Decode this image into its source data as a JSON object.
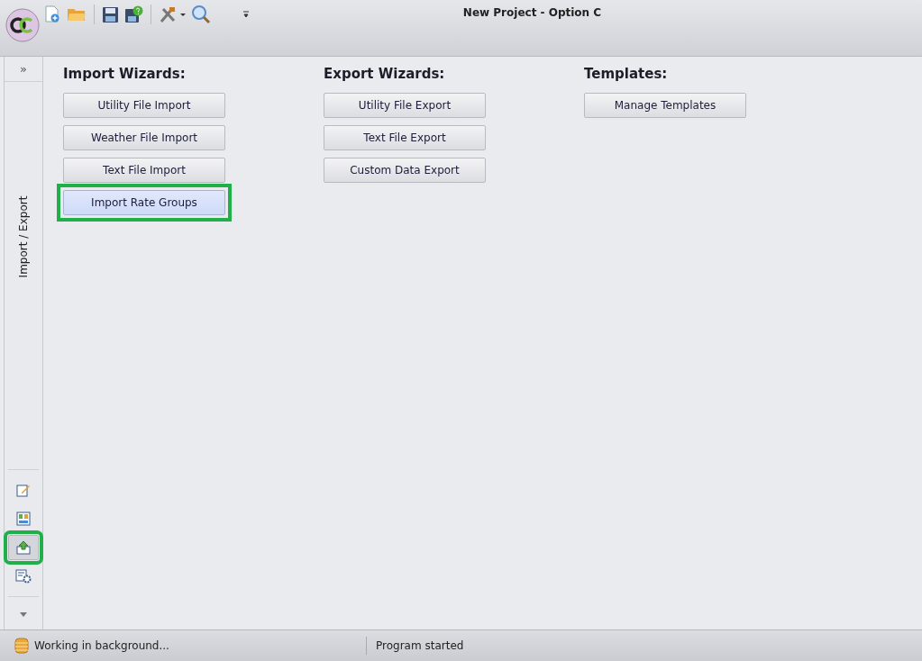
{
  "window": {
    "title": "New Project - Option C"
  },
  "sidebar": {
    "expand": "»",
    "panel_title": "Import / Export",
    "nav_items": [
      {
        "kind": "edit",
        "selected": false,
        "highlighted": false
      },
      {
        "kind": "layout",
        "selected": false,
        "highlighted": false
      },
      {
        "kind": "export",
        "selected": true,
        "highlighted": true
      },
      {
        "kind": "settings",
        "selected": false,
        "highlighted": false
      }
    ]
  },
  "sections": [
    {
      "title": "Import Wizards:",
      "buttons": [
        {
          "label": "Utility File Import",
          "hovered": false,
          "highlighted": false
        },
        {
          "label": "Weather File Import",
          "hovered": false,
          "highlighted": false
        },
        {
          "label": "Text File Import",
          "hovered": false,
          "highlighted": false
        },
        {
          "label": "Import Rate Groups",
          "hovered": true,
          "highlighted": true
        }
      ]
    },
    {
      "title": "Export Wizards:",
      "buttons": [
        {
          "label": "Utility File Export",
          "hovered": false,
          "highlighted": false
        },
        {
          "label": "Text File Export",
          "hovered": false,
          "highlighted": false
        },
        {
          "label": "Custom Data Export",
          "hovered": false,
          "highlighted": false
        }
      ]
    },
    {
      "title": "Templates:",
      "buttons": [
        {
          "label": "Manage Templates",
          "hovered": false,
          "highlighted": false
        }
      ]
    }
  ],
  "status_bar": {
    "left": "Working in background...",
    "right": "Program started"
  }
}
